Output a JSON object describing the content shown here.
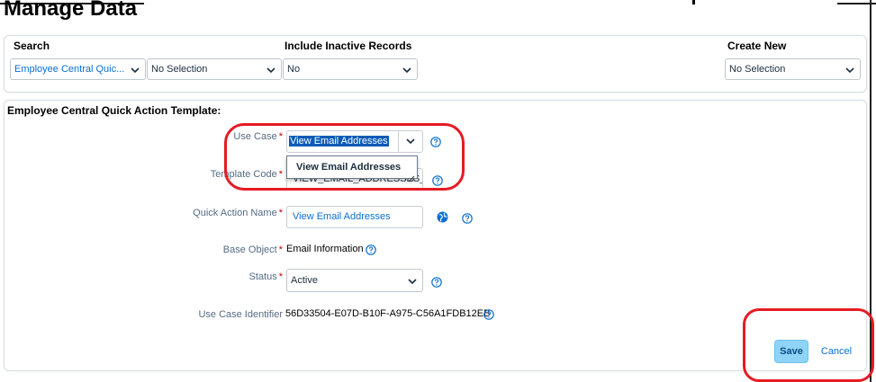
{
  "page": {
    "title": "Manage Data"
  },
  "search_panel": {
    "search_label": "Search",
    "search_type_value": "Employee Central Quic...",
    "search_item_value": "No Selection",
    "inactive_label": "Include Inactive Records",
    "inactive_value": "No",
    "create_label": "Create New",
    "create_value": "No Selection"
  },
  "form": {
    "heading": "Employee Central Quick Action Template:",
    "use_case_label": "Use Case",
    "use_case_value": "View Email Addresses",
    "use_case_dropdown_option": "View Email Addresses",
    "template_code_label": "Template Code",
    "template_code_value": "VIEW_EMAIL_ADDRESSES_1",
    "quick_action_name_label": "Quick Action Name",
    "quick_action_name_value": "View Email Addresses",
    "base_object_label": "Base Object",
    "base_object_value": "Email Information",
    "status_label": "Status",
    "status_value": "Active",
    "use_case_identifier_label": "Use Case Identifier",
    "use_case_identifier_value": "56D33504-E07D-B10F-A975-C56A1FDB12EB",
    "required_marker": "*"
  },
  "actions": {
    "save_label": "Save",
    "cancel_label": "Cancel"
  },
  "colors": {
    "annotation": "#e51b24",
    "link": "#0a6ed1",
    "save_bg": "#8fd4f7"
  },
  "icons": [
    "chevron-down-icon",
    "help-icon",
    "globe-icon"
  ]
}
